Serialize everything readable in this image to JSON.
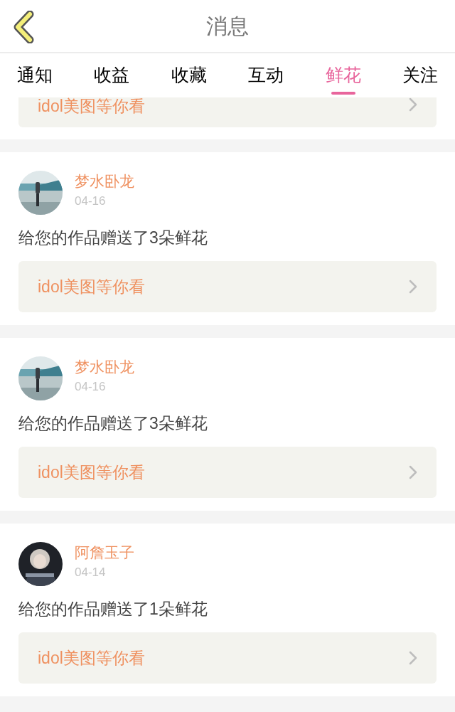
{
  "header": {
    "title": "消息"
  },
  "tabs": [
    {
      "label": "通知",
      "selected": false
    },
    {
      "label": "收益",
      "selected": false
    },
    {
      "label": "收藏",
      "selected": false
    },
    {
      "label": "互动",
      "selected": false
    },
    {
      "label": "鲜花",
      "selected": true
    },
    {
      "label": "关注",
      "selected": false
    }
  ],
  "partial_item": {
    "link": "idol美图等你看"
  },
  "items": [
    {
      "name": "梦水卧龙",
      "date": "04-16",
      "message": "给您的作品赠送了3朵鲜花",
      "link": "idol美图等你看"
    },
    {
      "name": "梦水卧龙",
      "date": "04-16",
      "message": "给您的作品赠送了3朵鲜花",
      "link": "idol美图等你看"
    },
    {
      "name": "阿詹玉子",
      "date": "04-14",
      "message": "给您的作品赠送了1朵鲜花",
      "link": "idol美图等你看"
    }
  ]
}
